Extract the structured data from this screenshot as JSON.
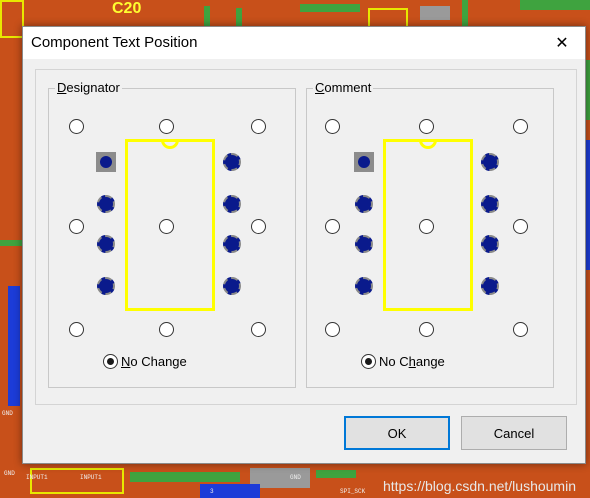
{
  "dialog": {
    "title": "Component Text Position",
    "close_glyph": "✕",
    "ok_label": "OK",
    "cancel_label": "Cancel"
  },
  "designator": {
    "legend_first": "D",
    "legend_rest": "esignator",
    "no_change_prefix": "N",
    "no_change_rest": "o Change",
    "selected": "no-change"
  },
  "comment": {
    "legend_first": "C",
    "legend_rest": "omment",
    "no_change_prefix": "No C",
    "no_change_mid": "h",
    "no_change_rest": "ange",
    "selected": "no-change"
  },
  "background": {
    "c20_label": "C20",
    "watermark": "https://blog.csdn.net/lushoumin",
    "pcb_labels": [
      "GND",
      "INPUT1",
      "SPI_SCK",
      "3",
      "GND",
      "INPUT1",
      "GND"
    ]
  },
  "colors": {
    "pcb_copper": "#c8501a",
    "chip_outline": "#ffff00",
    "pad": "#0a1a8c",
    "default_button_border": "#0078d7"
  }
}
